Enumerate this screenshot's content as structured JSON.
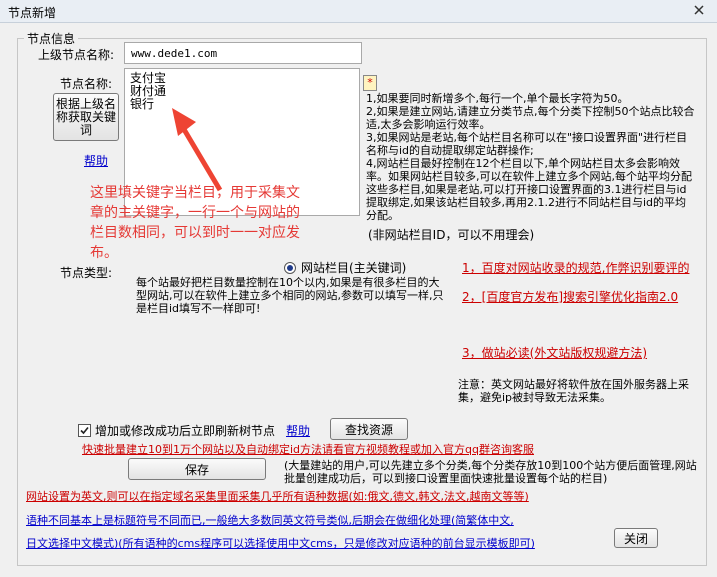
{
  "window": {
    "title": "节点新增",
    "close_glyph": "✕"
  },
  "group_title": "节点信息",
  "parent_node": {
    "label": "上级节点名称:",
    "value": "www.dede1.com"
  },
  "node_name": {
    "label": "节点名称:",
    "lines": [
      "支付宝",
      "财付通",
      "银行"
    ],
    "asterisk": "*"
  },
  "fetch_button": "根据上级名称获取关键词",
  "help_link": "帮助",
  "right_instructions": [
    "1,如果要同时新增多个,每行一个,单个最长字符为50。",
    "2,如果是建立网站,请建立分类节点,每个分类下控制50个站点比较合适,太多会影响运行效率。",
    "3,如果网站是老站,每个站栏目名称可以在\"接口设置界面\"进行栏目名称与id的自动提取绑定站群操作;",
    "4,网站栏目最好控制在12个栏目以下,单个网站栏目太多会影响效率。如果网站栏目较多,可以在软件上建立多个网站,每个站平均分配这些多栏目,如果是老站,可以打开接口设置界面的3.1进行栏目与id提取绑定,如果该站栏目较多,再用2.1.2进行不同站栏目与id的平均分配。"
  ],
  "annotation": "这里填关键字当栏目，用于采集文章的主关键字，一行一个与网站的栏目数相同，可以到时一一对应发布。",
  "no_id_note": "(非网站栏目ID，可以不用理会)",
  "node_type": {
    "label": "节点类型:",
    "radio_label": "网站栏目(主关键词)",
    "description": "每个站最好把栏目数量控制在10个以内,如果是有很多栏目的大型网站,可以在软件上建立多个相同的网站,参数可以填写一样,只是栏目id填写不一样即可!"
  },
  "red_links": [
    "1，百度对网站收录的规范,作弊识别要评的",
    "2，[百度官方发布]搜索引擎优化指南2.0",
    "3，做站必读(外文站版权规避方法)"
  ],
  "note": "注意：英文网站最好将软件放在国外服务器上采集，避免ip被封导致无法采集。",
  "refresh_checkbox": {
    "label": "增加或修改成功后立即刷新树节点",
    "checked": true
  },
  "help_link2": "帮助",
  "find_button": "查找资源",
  "batch_link": "快速批量建立10到1万个网站以及自动绑定id方法请看官方视频教程或加入官方qq群咨询客服",
  "save_button": "保存",
  "save_note": "(大量建站的用户,可以先建立多个分类,每个分类存放10到100个站方便后面管理,网站批量创建成功后，可以到接口设置里面快速批量设置每个站的栏目)",
  "language_red": "网站设置为英文,则可以在指定域名采集里面采集几乎所有语种数据(如:俄文,德文,韩文,法文,越南文等等)",
  "language_blue1": "语种不同基本上是标题符号不同而已,一般绝大多数同英文符号类似,后期会在做细化处理(简繁体中文,",
  "language_blue2": "日文选择中文模式)(所有语种的cms程序可以选择使用中文cms，只是修改对应语种的前台显示模板即可)",
  "close_button": "关闭",
  "colors": {
    "red": "#cc0000",
    "link_blue": "#0000cc",
    "arrow_red": "#ee4433"
  }
}
